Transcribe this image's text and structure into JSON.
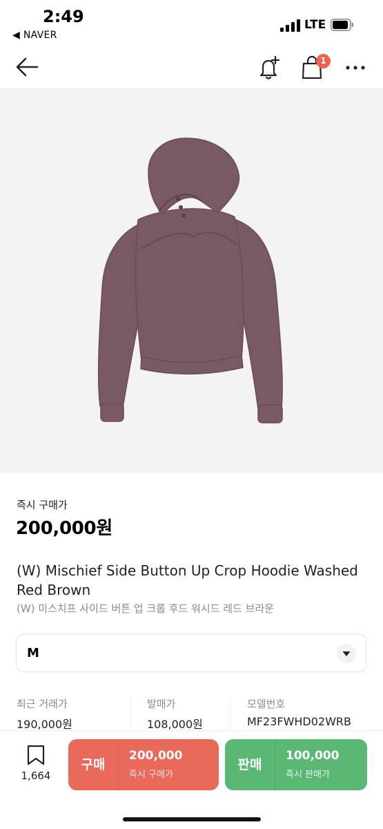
{
  "status": {
    "time": "2:49",
    "back_app": "◀ NAVER",
    "network": "LTE"
  },
  "nav": {
    "cart_badge": "1"
  },
  "product": {
    "image_icon": "hoodie-icon",
    "image_color": "#7a5a62",
    "price_label": "즉시 구매가",
    "price": "200,000원",
    "name_en": "(W) Mischief Side Button Up Crop Hoodie Washed Red Brown",
    "name_ko": "(W) 미스치프 사이드 버튼 업 크롭 후드 워시드 레드 브라운"
  },
  "size_select": {
    "value": "M"
  },
  "info": [
    {
      "label": "최근 거래가",
      "value": "190,000원"
    },
    {
      "label": "발매가",
      "value": "108,000원"
    },
    {
      "label": "모델번호",
      "value": "MF23FWHD02WRB"
    }
  ],
  "bottom": {
    "wish_count": "1,664",
    "buy": {
      "kind": "구매",
      "price": "200,000",
      "sub": "즉시 구매가",
      "color": "#e9695a"
    },
    "sell": {
      "kind": "판매",
      "price": "100,000",
      "sub": "즉시 판매가",
      "color": "#5ab874"
    }
  }
}
